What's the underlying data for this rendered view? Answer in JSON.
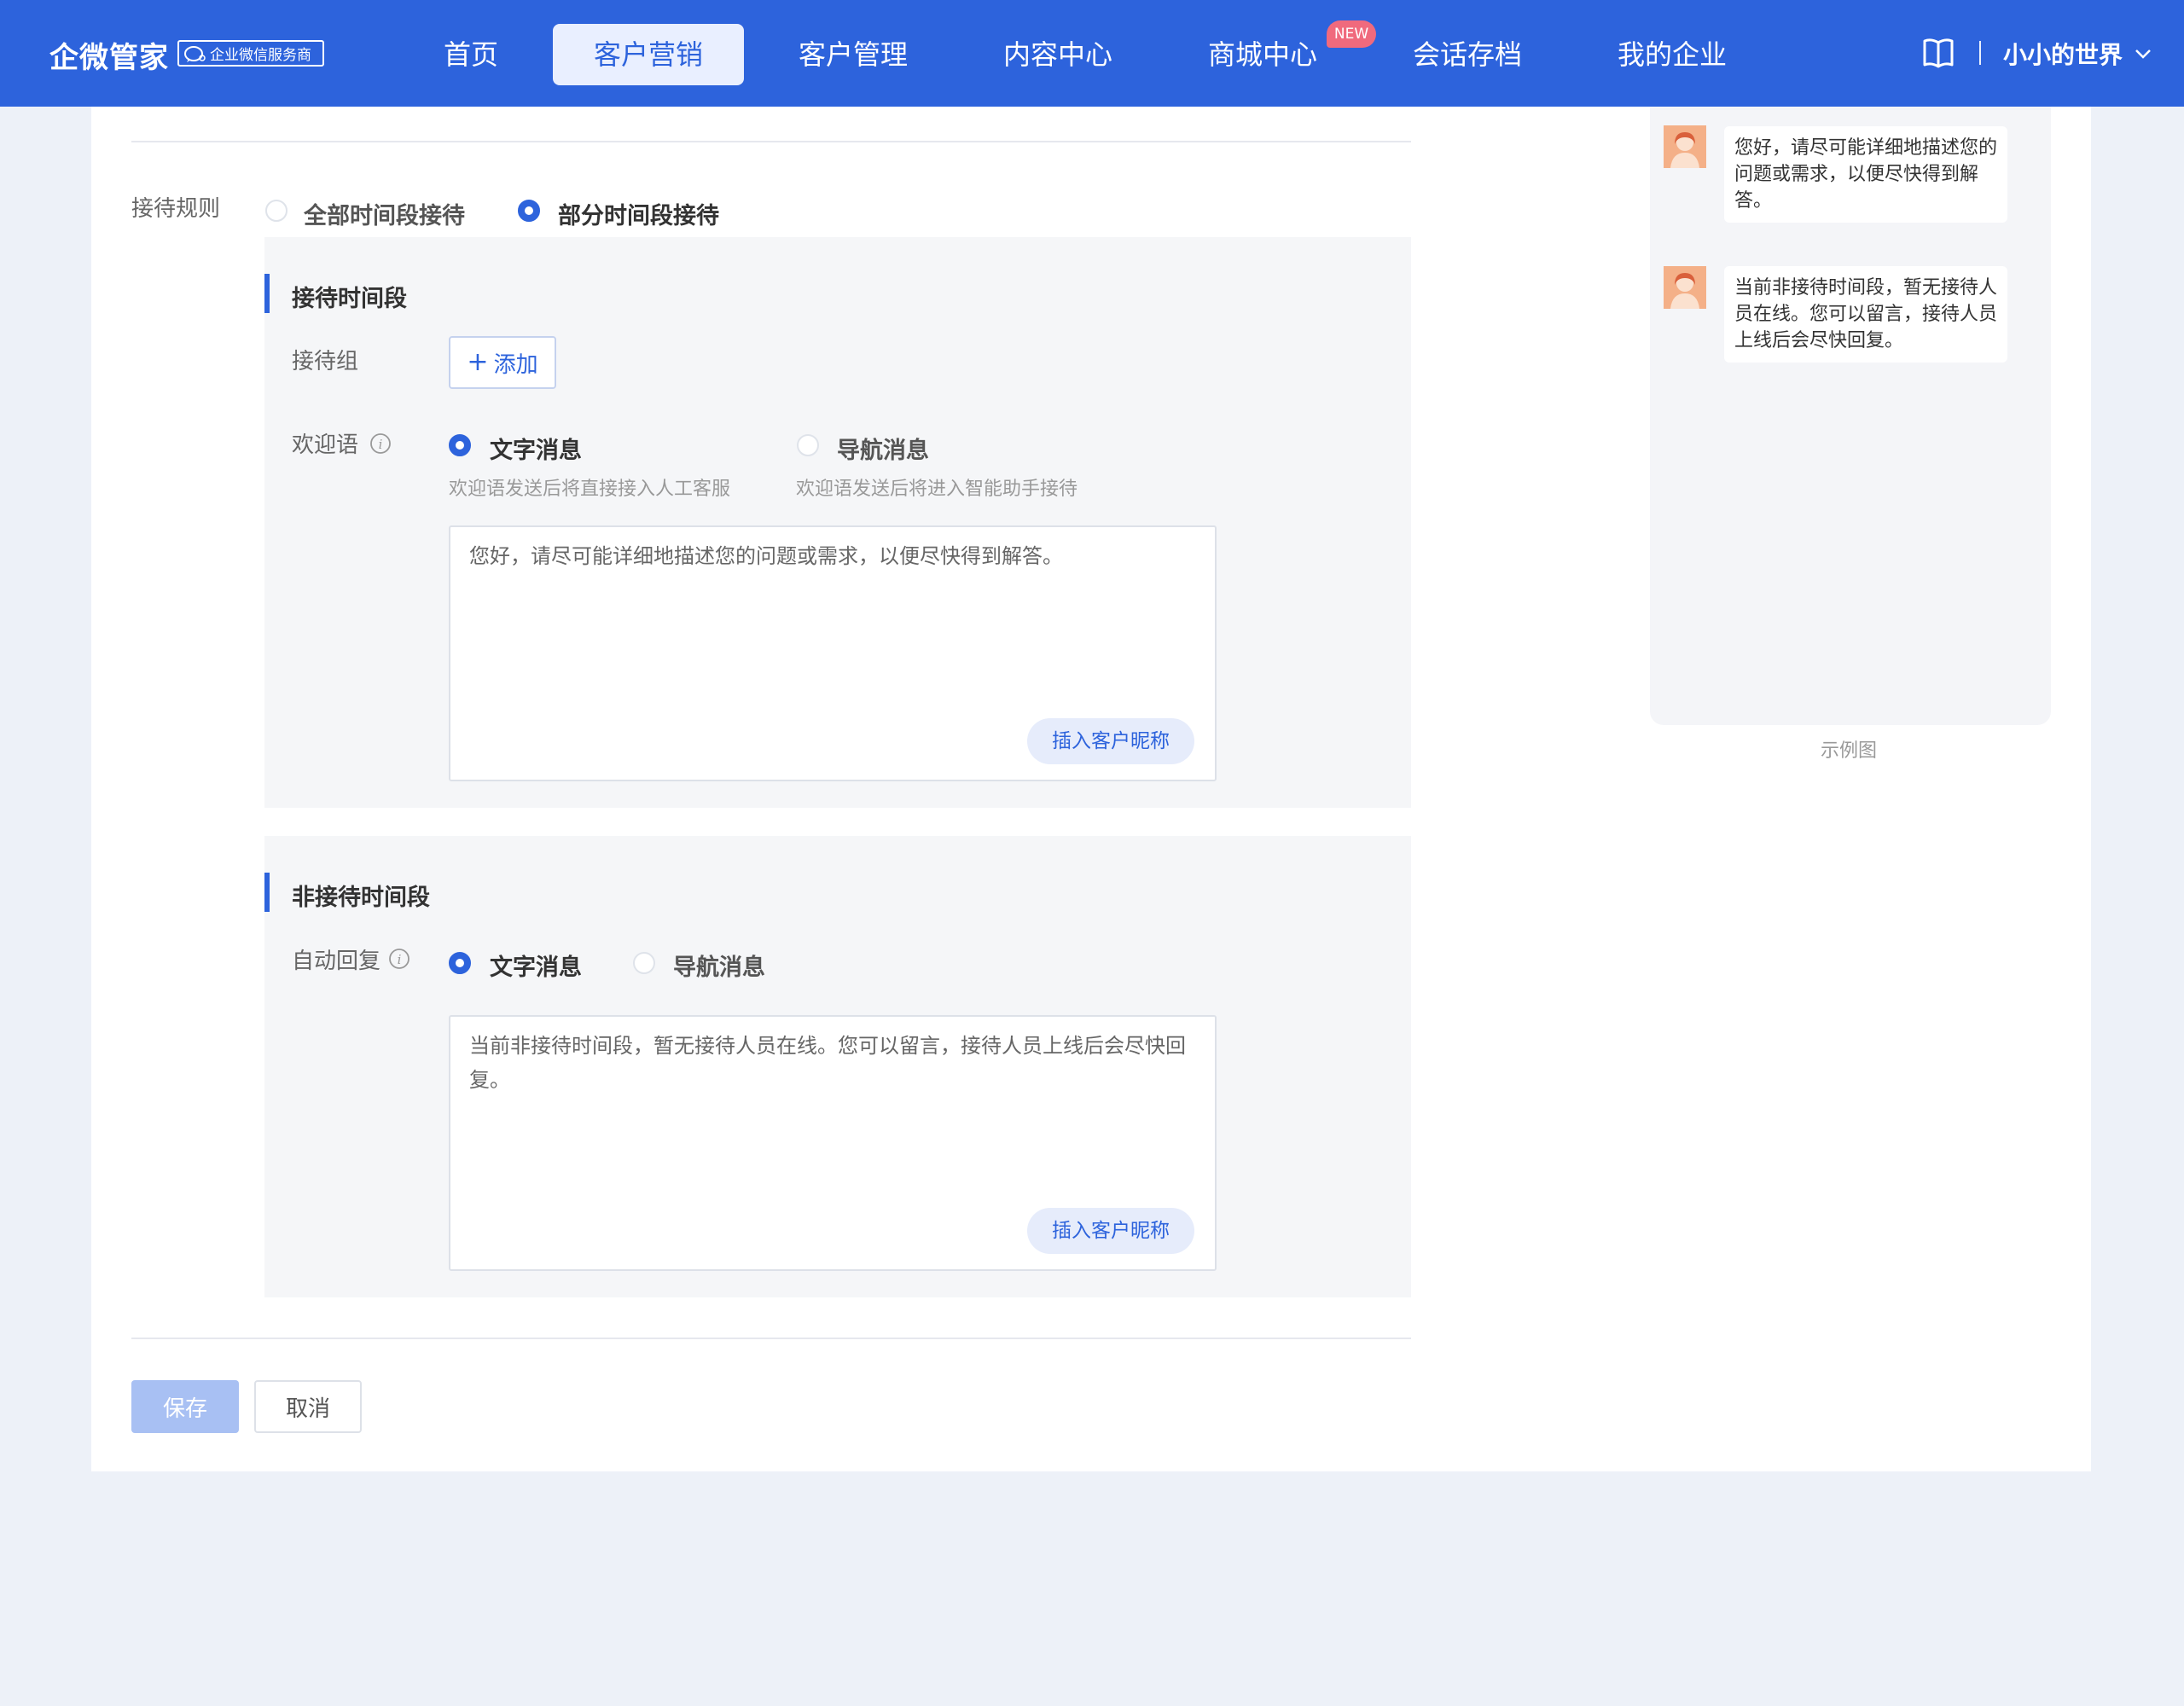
{
  "header": {
    "brand": "企微管家",
    "brand_tag": "企业微信服务商",
    "nav": [
      {
        "label": "首页"
      },
      {
        "label": "客户营销"
      },
      {
        "label": "客户管理"
      },
      {
        "label": "内容中心"
      },
      {
        "label": "商城中心"
      },
      {
        "label": "会话存档"
      },
      {
        "label": "我的企业"
      }
    ],
    "active_nav": "客户营销",
    "new_badge": "NEW",
    "user": "小小的世界",
    "accent_color": "#2d63dc"
  },
  "form": {
    "rule_label": "接待规则",
    "rule_options": [
      "全部时间段接待",
      "部分时间段接待"
    ],
    "rule_selected": "部分时间段接待",
    "reception": {
      "title": "接待时间段",
      "group_label": "接待组",
      "add_label": "添加",
      "welcome_label": "欢迎语",
      "options": [
        "文字消息",
        "导航消息"
      ],
      "hints": [
        "欢迎语发送后将直接接入人工客服",
        "欢迎语发送后将进入智能助手接待"
      ],
      "selected": "文字消息",
      "message": "您好，请尽可能详细地描述您的问题或需求，以便尽快得到解答。",
      "insert_label": "插入客户昵称"
    },
    "non_reception": {
      "title": "非接待时间段",
      "reply_label": "自动回复",
      "options": [
        "文字消息",
        "导航消息"
      ],
      "selected": "文字消息",
      "message": "当前非接待时间段，暂无接待人员在线。您可以留言，接待人员上线后会尽快回复。",
      "insert_label": "插入客户昵称"
    },
    "save_label": "保存",
    "cancel_label": "取消"
  },
  "preview": {
    "messages": [
      "您好，请尽可能详细地描述您的问题或需求，以便尽快得到解答。",
      "当前非接待时间段，暂无接待人员在线。您可以留言，接待人员上线后会尽快回复。"
    ],
    "caption": "示例图"
  }
}
